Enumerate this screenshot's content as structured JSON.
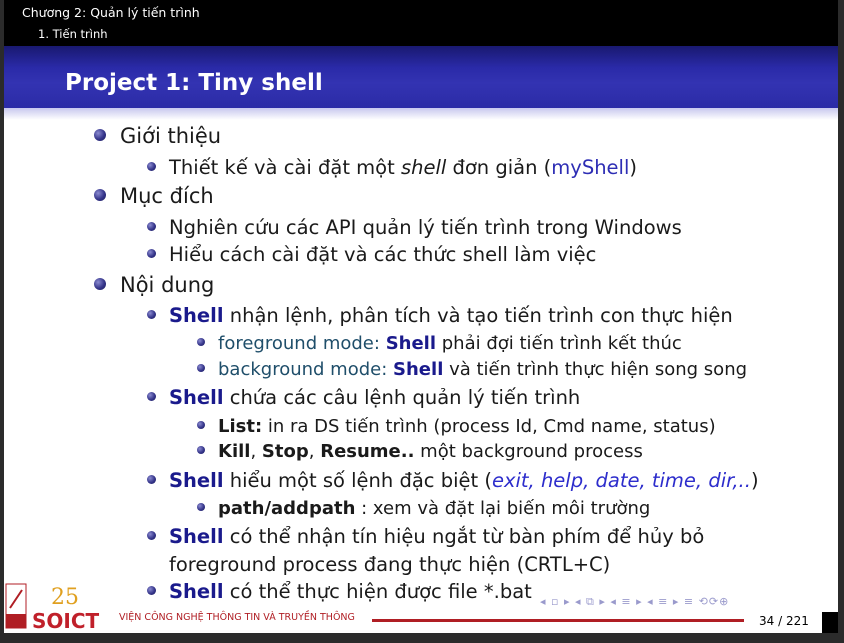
{
  "header": {
    "chapter": "Chương 2: Quản lý tiến trình",
    "section": "1. Tiến trình"
  },
  "title": "Project 1: Tiny shell",
  "content": {
    "intro": {
      "label": "Giới thiệu",
      "sub1_pre": "Thiết kế và cài đặt một ",
      "sub1_em": "shell",
      "sub1_mid": " đơn giản (",
      "sub1_name": "myShell",
      "sub1_post": ")"
    },
    "purpose": {
      "label": "Mục đích",
      "sub1": "Nghiên cứu các API quản lý tiến trình trong Windows",
      "sub2": "Hiểu cách cài đặt và các thức shell làm việc"
    },
    "contents": {
      "label": "Nội dung",
      "keyword": "Shell",
      "item1": " nhận lệnh, phân tích và tạo tiến trình con thực hiện",
      "fg_label": "foreground mode:",
      "fg_text": " phải đợi tiến trình kết thúc",
      "bg_label": "background mode:",
      "bg_text": " và tiến trình thực hiện song song",
      "item2": " chứa các câu lệnh quản lý tiến trình",
      "list_label": "List:",
      "list_text": " in ra DS tiến trình (process Id, Cmd name, status)",
      "kill": "Kill",
      "sep1": ", ",
      "stop": "Stop",
      "sep2": ", ",
      "resume": "Resume..",
      "kill_text": " một background process",
      "item3": " hiểu một số lệnh đặc biệt (",
      "item3_em": "exit, help, date, time, dir,..",
      "item3_post": ")",
      "path_label": "path/addpath",
      "path_text": " : xem và đặt lại biến môi trường",
      "item4a": " có thể nhận tín hiệu ngắt từ bàn phím để hủy bỏ",
      "item4b": "foreground process đang thực hiện (CRTL+C)",
      "item5": " có thể thực hiện được file *.bat"
    }
  },
  "footer": {
    "institute": "VIỆN CÔNG NGHỆ THÔNG TIN VÀ TRUYỀN THÔNG",
    "logo_text": "SOICT",
    "logo_number": "25",
    "page": "34 / 221"
  },
  "colors": {
    "title_bar": "#2a2aa8",
    "keyword": "#1a1a8c",
    "footer_red": "#b01e24"
  }
}
